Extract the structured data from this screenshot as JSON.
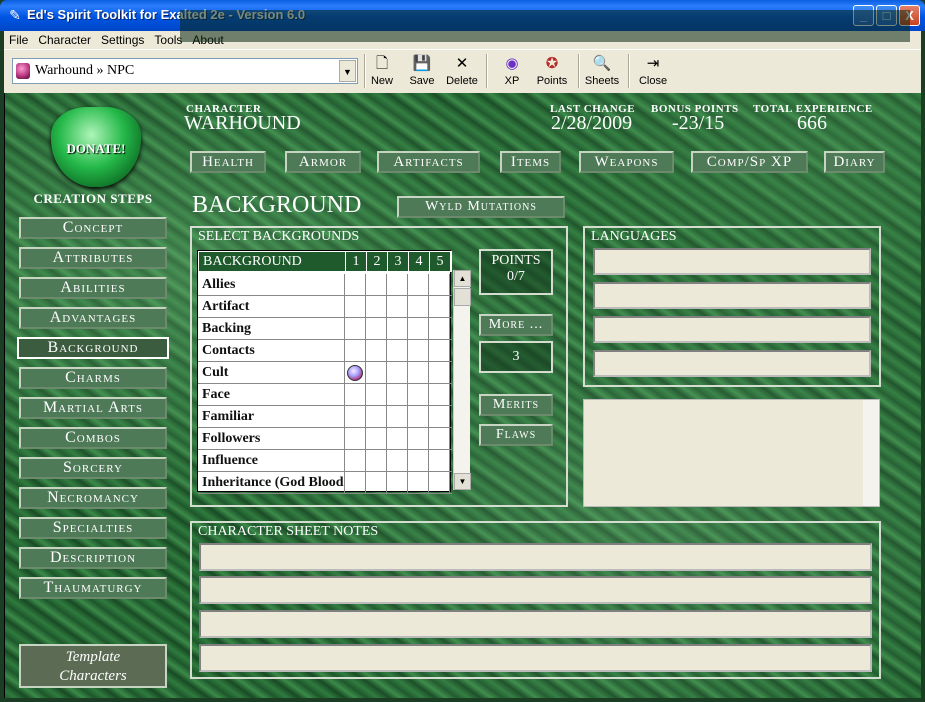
{
  "window": {
    "title": "Ed's Spirit Toolkit for Exalted 2e - Version 6.0",
    "controls": {
      "minimize": "_",
      "maximize": "□",
      "close": "X"
    }
  },
  "menu": [
    "File",
    "Character",
    "Settings",
    "Tools",
    "About"
  ],
  "toolbar": {
    "character_select": "Warhound » NPC",
    "buttons": [
      {
        "label": "New",
        "icon": "new-document-icon"
      },
      {
        "label": "Save",
        "icon": "floppy-icon"
      },
      {
        "label": "Delete",
        "icon": "x-icon"
      },
      {
        "label": "XP",
        "icon": "xp-icon"
      },
      {
        "label": "Points",
        "icon": "points-icon"
      },
      {
        "label": "Sheets",
        "icon": "sheets-icon"
      },
      {
        "label": "Close",
        "icon": "close-door-icon"
      }
    ]
  },
  "sidebar": {
    "donate": "DONATE!",
    "creation_steps": "CREATION STEPS",
    "steps": [
      "Concept",
      "Attributes",
      "Abilities",
      "Advantages",
      "Background",
      "Charms",
      "Martial Arts",
      "Combos",
      "Sorcery",
      "Necromancy",
      "Specialties",
      "Description",
      "Thaumaturgy"
    ],
    "active_step": "Background",
    "template_characters_line1": "Template",
    "template_characters_line2": "Characters"
  },
  "header": {
    "character_label": "CHARACTER",
    "character_name": "WARHOUND",
    "last_change_label": "LAST CHANGE",
    "last_change": "2/28/2009",
    "bonus_points_label": "BONUS POINTS",
    "bonus_points": "-23/15",
    "total_experience_label": "TOTAL EXPERIENCE",
    "total_experience": "666"
  },
  "nav": [
    "Health",
    "Armor",
    "Artifacts",
    "Items",
    "Weapons",
    "Comp/Sp XP",
    "Diary"
  ],
  "background_section": {
    "title": "BACKGROUND",
    "wyld_button": "Wyld Mutations",
    "select_label": "SELECT BACKGROUNDS",
    "table_header": {
      "name": "BACKGROUND",
      "levels": [
        "1",
        "2",
        "3",
        "4",
        "5"
      ]
    },
    "rows": [
      {
        "name": "Allies",
        "level": 0
      },
      {
        "name": "Artifact",
        "level": 0
      },
      {
        "name": "Backing",
        "level": 0
      },
      {
        "name": "Contacts",
        "level": 0
      },
      {
        "name": "Cult",
        "level": 1
      },
      {
        "name": "Face",
        "level": 0
      },
      {
        "name": "Familiar",
        "level": 0
      },
      {
        "name": "Followers",
        "level": 0
      },
      {
        "name": "Influence",
        "level": 0
      },
      {
        "name": "Inheritance (God Blood)",
        "level": 0
      }
    ],
    "points_label": "POINTS",
    "points_value": "0/7",
    "more_button": "More ...",
    "more_value": "3",
    "merits_button": "Merits",
    "flaws_button": "Flaws"
  },
  "languages": {
    "label": "LANGUAGES",
    "fields": [
      "",
      "",
      "",
      ""
    ],
    "notes": ""
  },
  "sheet_notes": {
    "label": "CHARACTER SHEET NOTES",
    "fields": [
      "",
      "",
      "",
      ""
    ]
  }
}
